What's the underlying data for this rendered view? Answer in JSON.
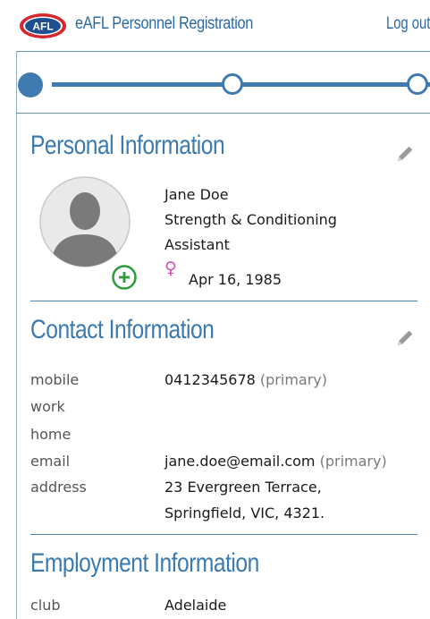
{
  "app": {
    "logo_text": "AFL",
    "title": "eAFL Personnel Registration",
    "logout_label": "Log out"
  },
  "stepper": {
    "steps_total": 3,
    "current_step": 1
  },
  "personal": {
    "heading": "Personal Information",
    "name": "Jane Doe",
    "role_line1": "Strength & Conditioning",
    "role_line2": "Assistant",
    "gender_symbol": "♀",
    "dob": "Apr 16, 1985"
  },
  "contact": {
    "heading": "Contact Information",
    "mobile_label": "mobile",
    "mobile_value": "0412345678",
    "mobile_tag": "(primary)",
    "work_label": "work",
    "home_label": "home",
    "email_label": "email",
    "email_value": "jane.doe@email.com",
    "email_tag": "(primary)",
    "address_label": "address",
    "address_line1": "23 Evergreen Terrace,",
    "address_line2": "Springfield, VIC, 4321."
  },
  "employment": {
    "heading": "Employment Information",
    "club_label": "club",
    "club_value": "Adelaide"
  },
  "colors": {
    "accent": "#3a7aae",
    "gender_female": "#d84fb5",
    "add_green": "#2e9a3a"
  },
  "icons": {
    "logo": "afl-logo-icon",
    "edit": "pencil-icon",
    "avatar": "person-silhouette-icon",
    "add": "add-circle-icon",
    "gender": "female-symbol-icon"
  }
}
